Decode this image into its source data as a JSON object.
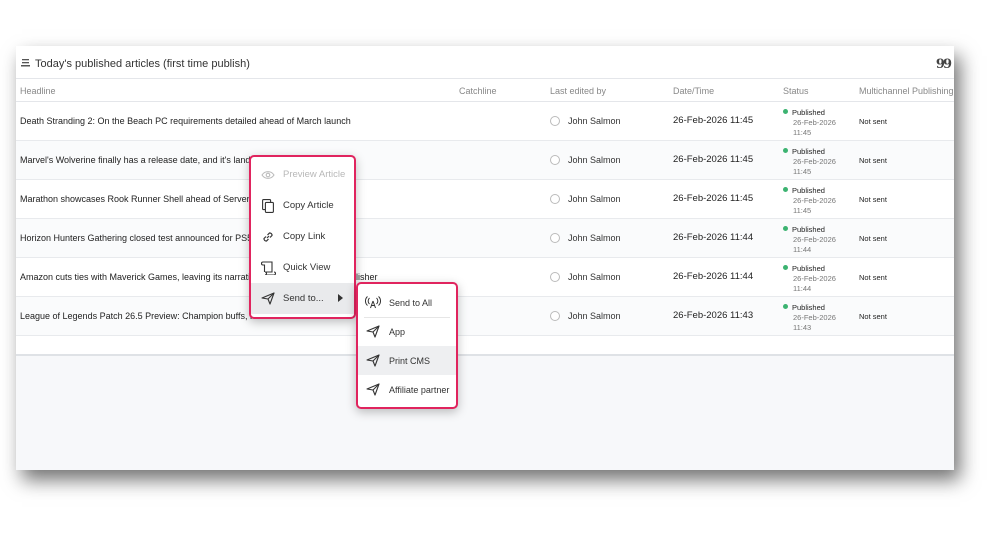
{
  "panel": {
    "title": "Today's published articles (first time publish)"
  },
  "columns": [
    "Headline",
    "Catchline",
    "Last edited by",
    "Date/Time",
    "Status",
    "Multichannel Publishing"
  ],
  "rows": [
    {
      "headline": "Death Stranding 2: On the Beach PC requirements detailed ahead of March launch",
      "editor": "John Salmon",
      "datetime": "26-Feb-2026 11:45",
      "status": "Published",
      "status_date": "26-Feb-2026",
      "status_time": "11:45",
      "multichannel": "Not sent"
    },
    {
      "headline": "Marvel's Wolverine finally has a release date, and it's landing",
      "editor": "John Salmon",
      "datetime": "26-Feb-2026 11:45",
      "status": "Published",
      "status_date": "26-Feb-2026",
      "status_time": "11:45",
      "multichannel": "Not sent"
    },
    {
      "headline": "Marathon showcases Rook Runner Shell ahead of Server Sla",
      "editor": "John Salmon",
      "datetime": "26-Feb-2026 11:45",
      "status": "Published",
      "status_date": "26-Feb-2026",
      "status_time": "11:45",
      "multichannel": "Not sent"
    },
    {
      "headline": "Horizon Hunters Gathering closed test announced for PS5 ar",
      "editor": "John Salmon",
      "datetime": "26-Feb-2026 11:44",
      "status": "Published",
      "status_date": "26-Feb-2026",
      "status_time": "11:44",
      "multichannel": "Not sent"
    },
    {
      "headline": "Amazon cuts ties with Maverick Games, leaving its narrative",
      "headline_tail": "lisher",
      "editor": "John Salmon",
      "datetime": "26-Feb-2026 11:44",
      "status": "Published",
      "status_date": "26-Feb-2026",
      "status_time": "11:44",
      "multichannel": "Not sent"
    },
    {
      "headline": "League of Legends Patch 26.5 Preview: Champion buffs, ner",
      "editor": "John Salmon",
      "datetime": "26-Feb-2026 11:43",
      "status": "Published",
      "status_date": "26-Feb-2026",
      "status_time": "11:43",
      "multichannel": "Not sent"
    }
  ],
  "context_menu": {
    "items": [
      {
        "label": "Preview Article",
        "icon": "eye-icon",
        "disabled": true
      },
      {
        "label": "Copy Article",
        "icon": "copy-icon"
      },
      {
        "label": "Copy Link",
        "icon": "link-icon"
      },
      {
        "label": "Quick View",
        "icon": "scroll-icon"
      },
      {
        "label": "Send to...",
        "icon": "send-icon"
      }
    ]
  },
  "submenu": {
    "items": [
      {
        "label": "Send to All",
        "icon": "broadcast-icon"
      },
      {
        "label": "App",
        "icon": "send-icon"
      },
      {
        "label": "Print CMS",
        "icon": "send-icon"
      },
      {
        "label": "Affiliate partner",
        "icon": "send-icon"
      }
    ]
  },
  "colors": {
    "highlight_border": "#e0245e",
    "status_published": "#3cb371"
  }
}
